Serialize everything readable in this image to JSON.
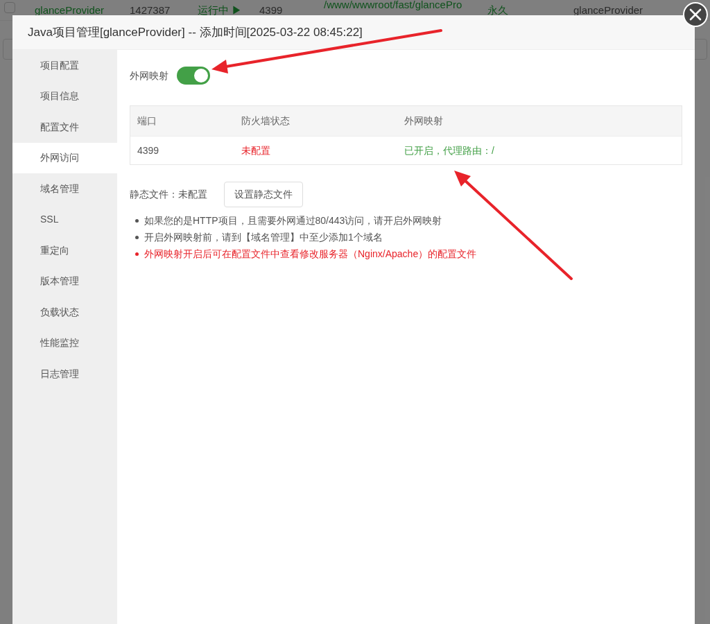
{
  "background_row": {
    "checked": false,
    "cells": [
      {
        "text": "glanceProvider",
        "kind": "link"
      },
      {
        "text": "1427387",
        "kind": "plain"
      },
      {
        "text": "运行中 ▶",
        "kind": "status"
      },
      {
        "text": "4399",
        "kind": "plain"
      },
      {
        "text": "/www/wwwroot/fast/glancePro",
        "kind": "path"
      },
      {
        "text": "永久",
        "kind": "status"
      },
      {
        "text": "glanceProvider",
        "kind": "plain"
      }
    ]
  },
  "window": {
    "title": "Java项目管理[glanceProvider] -- 添加时间[2025-03-22 08:45:22]"
  },
  "sidebar": {
    "items": [
      {
        "label": "项目配置",
        "selected": false
      },
      {
        "label": "项目信息",
        "selected": false
      },
      {
        "label": "配置文件",
        "selected": false
      },
      {
        "label": "外网访问",
        "selected": true
      },
      {
        "label": "域名管理",
        "selected": false
      },
      {
        "label": "SSL",
        "selected": false
      },
      {
        "label": "重定向",
        "selected": false
      },
      {
        "label": "版本管理",
        "selected": false
      },
      {
        "label": "负载状态",
        "selected": false
      },
      {
        "label": "性能监控",
        "selected": false
      },
      {
        "label": "日志管理",
        "selected": false
      }
    ]
  },
  "mapping_toggle": {
    "label": "外网映射",
    "on": true
  },
  "table": {
    "columns": [
      "端口",
      "防火墙状态",
      "外网映射"
    ],
    "rows": [
      [
        {
          "text": "4399",
          "kind": "plain"
        },
        {
          "text": "未配置",
          "kind": "error"
        },
        {
          "text": "已开启，代理路由：/",
          "kind": "success"
        }
      ]
    ]
  },
  "static_files": {
    "label": "静态文件：未配置",
    "button": "设置静态文件"
  },
  "notes": [
    {
      "text": "如果您的是HTTP项目，且需要外网通过80/443访问，请开启外网映射",
      "kind": "info"
    },
    {
      "text": "开启外网映射前，请到【域名管理】中至少添加1个域名",
      "kind": "info"
    },
    {
      "text": "外网映射开启后可在配置文件中查看修改服务器（Nginx/Apache）的配置文件",
      "kind": "warning"
    }
  ]
}
